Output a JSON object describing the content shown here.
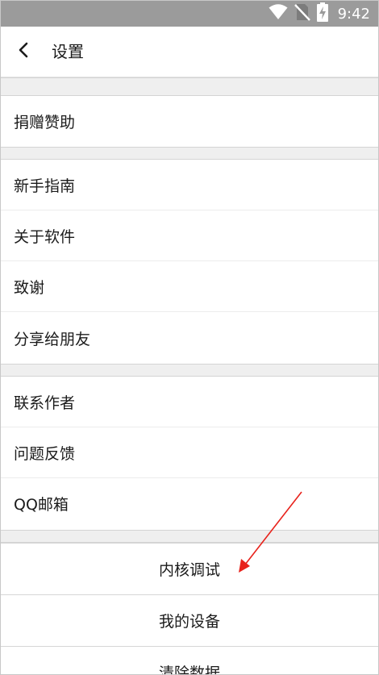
{
  "status_bar": {
    "time": "9:42",
    "icons": [
      "wifi-icon",
      "no-sim-icon",
      "battery-charging-icon"
    ],
    "background": "#9b9b9b"
  },
  "app_bar": {
    "title": "设置",
    "back_icon": "back-arrow-icon"
  },
  "groups": [
    {
      "items": [
        "捐赠赞助"
      ]
    },
    {
      "items": [
        "新手指南",
        "关于软件",
        "致谢",
        "分享给朋友"
      ]
    },
    {
      "items": [
        "联系作者",
        "问题反馈",
        "QQ邮箱"
      ]
    }
  ],
  "buttons": [
    "内核调试",
    "我的设备",
    "清除数据"
  ],
  "annotation": {
    "color": "#e8221b",
    "points_to": "内核调试"
  }
}
